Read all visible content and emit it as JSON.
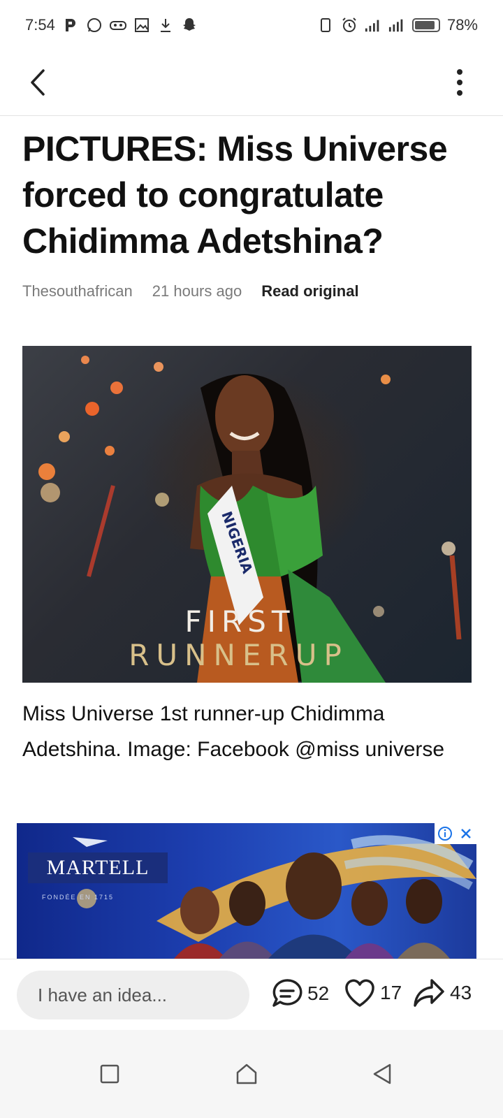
{
  "status_bar": {
    "time": "7:54",
    "battery": "78%",
    "left_icons": [
      "pocket-icon",
      "whatsapp-icon",
      "gamepad-icon",
      "gallery-icon",
      "download-icon",
      "snapchat-icon"
    ],
    "right_icons": [
      "vibrate-icon",
      "alarm-icon",
      "signal-icon",
      "signal-icon",
      "battery-icon"
    ],
    "battery_level": 0.78
  },
  "app_bar": {
    "back_icon": "chevron-left-icon",
    "menu_icon": "more-vertical-icon"
  },
  "article": {
    "title": "PICTURES: Miss Universe forced to congratulate Chidimma Adetshina?",
    "source": "Thesouthafrican",
    "time_ago": "21 hours ago",
    "read_original": "Read original",
    "image_overlay_line1": "FIRST",
    "image_overlay_line2": "RUNNERUP",
    "sash_text": "NIGERIA",
    "caption": "Miss Universe 1st runner-up Chidimma Adetshina. Image: Facebook @miss universe"
  },
  "ad": {
    "brand": "MARTELL",
    "sub": "FONDÉE EN 1715",
    "info_icon": "info-icon",
    "close_icon": "close-icon"
  },
  "action_bar": {
    "input_placeholder": "I have an idea...",
    "comments_count": "52",
    "likes_count": "17",
    "shares_count": "43"
  },
  "nav_bar": {
    "icons": [
      "recent-apps-icon",
      "home-icon",
      "back-icon"
    ]
  },
  "colors": {
    "ad_bg": "#1d3fb0",
    "accent_gold": "#d8c08a",
    "info_blue": "#1a73e8"
  }
}
